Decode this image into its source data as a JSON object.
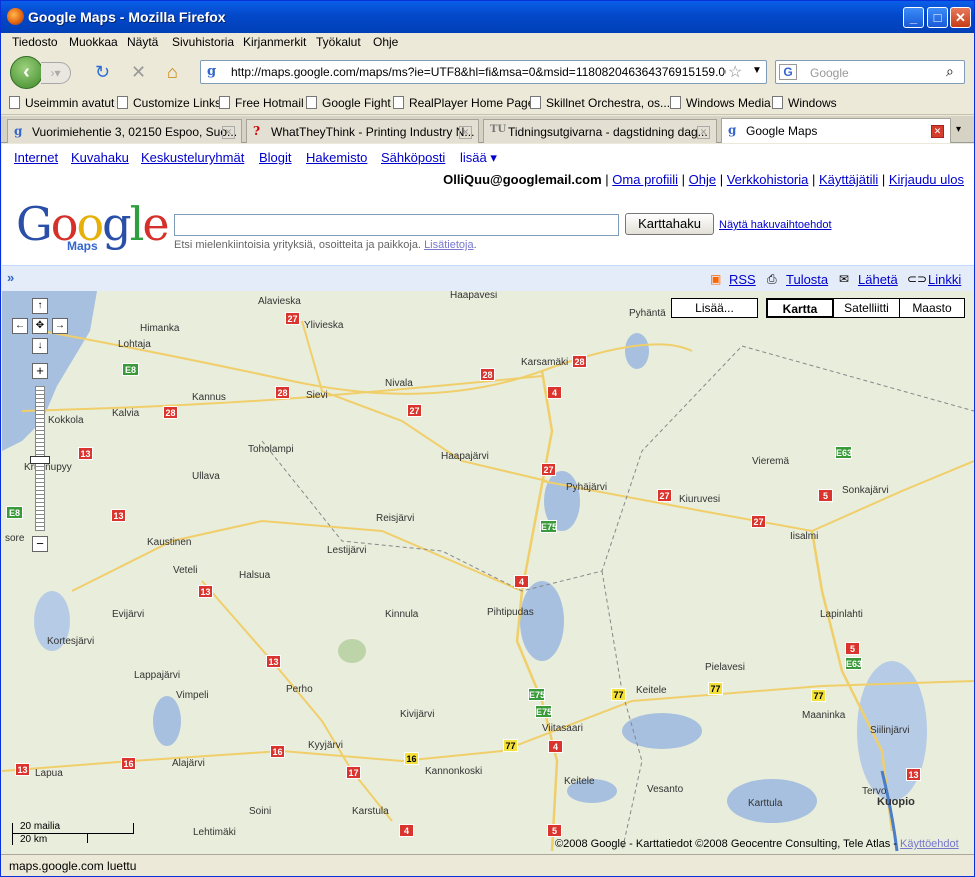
{
  "window": {
    "title": "Google Maps - Mozilla Firefox"
  },
  "menu": [
    "Tiedosto",
    "Muokkaa",
    "Näytä",
    "Sivuhistoria",
    "Kirjanmerkit",
    "Työkalut",
    "Ohje"
  ],
  "address": {
    "url": "http://maps.google.com/maps/ms?ie=UTF8&hl=fi&msa=0&msid=118082046364376915159.000453c6",
    "search_placeholder": "Google"
  },
  "bookmarks": [
    "Useimmin avatut",
    "Customize Links",
    "Free Hotmail",
    "Google Fight",
    "RealPlayer Home Page",
    "Skillnet Orchestra, os...",
    "Windows Media",
    "Windows"
  ],
  "tabs": [
    {
      "label": "Vuorimiehentie 3, 02150 Espoo, Suo...",
      "active": false
    },
    {
      "label": "WhatTheyThink - Printing Industry N...",
      "active": false
    },
    {
      "label": "Tidningsutgivarna - dagstidning dag...",
      "active": false
    },
    {
      "label": "Google Maps",
      "active": true
    }
  ],
  "google_nav": [
    "Internet",
    "Kuvahaku",
    "Keskusteluryhmät",
    "Blogit",
    "Hakemisto",
    "Sähköposti",
    "lisää ▾"
  ],
  "user": {
    "email": "OlliQuu@googlemail.com",
    "links": [
      "Oma profiili",
      "Ohje",
      "Verkkohistoria",
      "Käyttäjätili",
      "Kirjaudu ulos"
    ]
  },
  "logo": {
    "text": "Google",
    "sub": "Maps"
  },
  "search": {
    "button": "Karttahaku",
    "options": "Näytä hakuvaihtoehdot",
    "hint": "Etsi mielenkiintoisia yrityksiä, osoitteita ja paikkoja.",
    "hint_link": "Lisätietoja"
  },
  "map_actions": [
    "RSS",
    "Tulosta",
    "Lähetä",
    "Linkki"
  ],
  "map_types": {
    "more": "Lisää...",
    "map": "Kartta",
    "satellite": "Satelliitti",
    "terrain": "Maasto"
  },
  "places": [
    "Alavieska",
    "Haapavesi",
    "Pyhäntä",
    "Ylivieska",
    "Himanka",
    "Lohtaja",
    "Karsamäki",
    "Nivala",
    "Sievi",
    "Kannus",
    "Kalvia",
    "Kokkola",
    "Toholampi",
    "Haapajärvi",
    "Kruunupyy",
    "Ullava",
    "Pyhäjärvi",
    "Kiuruvesi",
    "Vieremä",
    "Sonkajärvi",
    "Reisjärvi",
    "Iisalmi",
    "Kaustinen",
    "Lestijärvi",
    "Veteli",
    "Halsua",
    "Pihtipudas",
    "Kinnula",
    "Evijärvi",
    "Kortesjärvi",
    "Lapinlahti",
    "Pielavesi",
    "Lappajärvi",
    "Perho",
    "Vimpeli",
    "Keitele",
    "Maaninka",
    "Kivijärvi",
    "Viitasaari",
    "Siilinjärvi",
    "Kyyjärvi",
    "Alajärvi",
    "Lapua",
    "Kannonkoski",
    "Keitele",
    "Vesanto",
    "Soini",
    "Karstula",
    "Tervo",
    "Kuopio",
    "Karttula",
    "Lehtimäki",
    "sore"
  ],
  "roads": [
    "27",
    "28",
    "28",
    "28",
    "27",
    "4",
    "E8",
    "28",
    "27",
    "13",
    "27",
    "5",
    "E63",
    "13",
    "E75",
    "27",
    "E8",
    "4",
    "13",
    "5",
    "E63",
    "13",
    "E75",
    "77",
    "77",
    "77",
    "E75",
    "4",
    "77",
    "16",
    "16",
    "16",
    "13",
    "17",
    "13",
    "4",
    "5"
  ],
  "scale": {
    "miles": "20 mailia",
    "km": "20 km"
  },
  "copyright": "©2008 Google - Karttatiedot ©2008 Geocentre Consulting, Tele Atlas -",
  "terms": "Käyttöehdot",
  "status": "maps.google.com luettu"
}
